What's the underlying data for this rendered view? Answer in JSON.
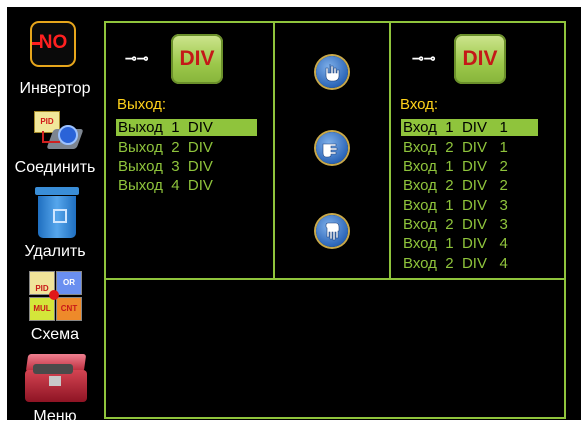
{
  "toolbar": {
    "inverter": {
      "label": "Инвертор",
      "icon_text": "NO"
    },
    "connect": {
      "label": "Соединить",
      "icon_text": "PID"
    },
    "delete": {
      "label": "Удалить"
    },
    "scheme": {
      "label": "Схема",
      "blocks": [
        "PID",
        "OR",
        "MUL",
        "CNT"
      ]
    },
    "menu": {
      "label": "Меню"
    }
  },
  "output_panel": {
    "plug_glyph": "⊸⊸",
    "block_label": "DIV",
    "header": "Выход:",
    "items": [
      "Выход  1  DIV",
      "Выход  2  DIV",
      "Выход  3  DIV",
      "Выход  4  DIV"
    ],
    "selected_index": 0
  },
  "input_panel": {
    "plug_glyph": "⊸⊸",
    "block_label": "DIV",
    "header": "Вход:",
    "items": [
      "Вход  1  DIV   1",
      "Вход  2  DIV   1",
      "Вход  1  DIV   2",
      "Вход  2  DIV   2",
      "Вход  1  DIV   3",
      "Вход  2  DIV   3",
      "Вход  1  DIV   4",
      "Вход  2  DIV   4"
    ],
    "selected_index": 0
  },
  "middle_buttons": [
    "hand-up-icon",
    "hand-point-icon",
    "hand-down-icon"
  ],
  "colors": {
    "accent": "#8fc43c",
    "header": "#ffd21a",
    "background": "#000000"
  }
}
